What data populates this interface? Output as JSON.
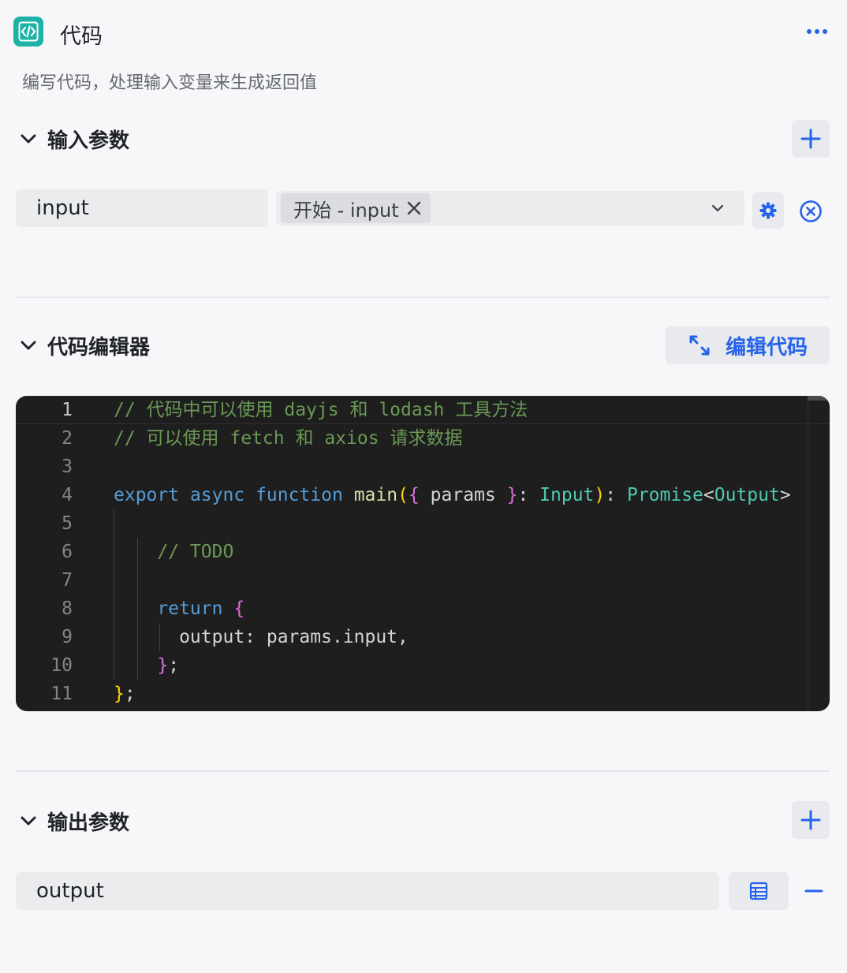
{
  "node": {
    "title": "代码",
    "description": "编写代码，处理输入变量来生成返回值",
    "icon": "code-brackets-icon",
    "accent_color": "#1cb3a6"
  },
  "input_section": {
    "title": "输入参数",
    "params": [
      {
        "name": "input",
        "source_tag": "开始 - input"
      }
    ]
  },
  "editor_section": {
    "title": "代码编辑器",
    "edit_button_label": "编辑代码",
    "line_numbers": [
      "1",
      "2",
      "3",
      "4",
      "5",
      "6",
      "7",
      "8",
      "9",
      "10",
      "11"
    ],
    "lines": [
      [
        [
          "c-com",
          "// 代码中可以使用 dayjs 和 lodash 工具方法"
        ]
      ],
      [
        [
          "c-com",
          "// 可以使用 fetch 和 axios 请求数据"
        ]
      ],
      [],
      [
        [
          "c-kw",
          "export"
        ],
        [
          "c-id",
          " "
        ],
        [
          "c-kw",
          "async"
        ],
        [
          "c-id",
          " "
        ],
        [
          "c-kw",
          "function"
        ],
        [
          "c-id",
          " "
        ],
        [
          "c-fn",
          "main"
        ],
        [
          "c-br1",
          "("
        ],
        [
          "c-br2",
          "{"
        ],
        [
          "c-id",
          " params "
        ],
        [
          "c-br2",
          "}"
        ],
        [
          "c-id",
          ": "
        ],
        [
          "c-ty",
          "Input"
        ],
        [
          "c-br1",
          ")"
        ],
        [
          "c-id",
          ": "
        ],
        [
          "c-ty",
          "Promise"
        ],
        [
          "c-id",
          "<"
        ],
        [
          "c-ty",
          "Output"
        ],
        [
          "c-id",
          ">"
        ]
      ],
      [],
      [
        [
          "c-id",
          "    "
        ],
        [
          "c-com",
          "// TODO"
        ]
      ],
      [],
      [
        [
          "c-id",
          "    "
        ],
        [
          "c-kw",
          "return"
        ],
        [
          "c-id",
          " "
        ],
        [
          "c-br2",
          "{"
        ]
      ],
      [
        [
          "c-id",
          "      output: params.input,"
        ]
      ],
      [
        [
          "c-id",
          "    "
        ],
        [
          "c-br2",
          "}"
        ],
        [
          "c-id",
          ";"
        ]
      ],
      [
        [
          "c-br1",
          "}"
        ],
        [
          "c-id",
          ";"
        ]
      ]
    ]
  },
  "output_section": {
    "title": "输出参数",
    "params": [
      {
        "name": "output"
      }
    ]
  },
  "colors": {
    "primary": "#2563eb",
    "editor_bg": "#1e1e1e"
  }
}
